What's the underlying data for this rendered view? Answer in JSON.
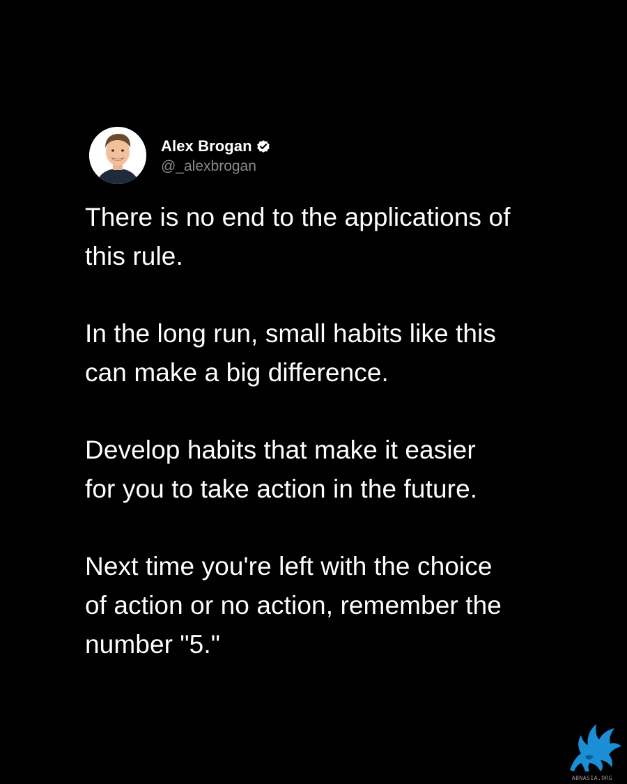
{
  "author": {
    "display_name": "Alex Brogan",
    "handle": "@_alexbrogan",
    "verified": true,
    "avatar_icon": "person-avatar"
  },
  "tweet": {
    "paragraphs": [
      {
        "line1": "There is no end to the applications of",
        "line2": "this rule."
      },
      {
        "line1": "In the long run, small habits like this",
        "line2": "can make a big difference."
      },
      {
        "line1": "Develop habits that make it easier",
        "line2": "for you to take action in the future."
      },
      {
        "line1": "Next time you're left with the choice",
        "line2": "of action or no action, remember the",
        "line3": "number \"5.\""
      }
    ]
  },
  "watermark": {
    "text": "ABNASIA.ORG",
    "icon": "griffin-logo-icon"
  },
  "colors": {
    "background": "#000000",
    "text": "#ffffff",
    "handle": "#8b8b8b",
    "verified": "#ffffff",
    "watermark_accent": "#1a8fd6"
  }
}
